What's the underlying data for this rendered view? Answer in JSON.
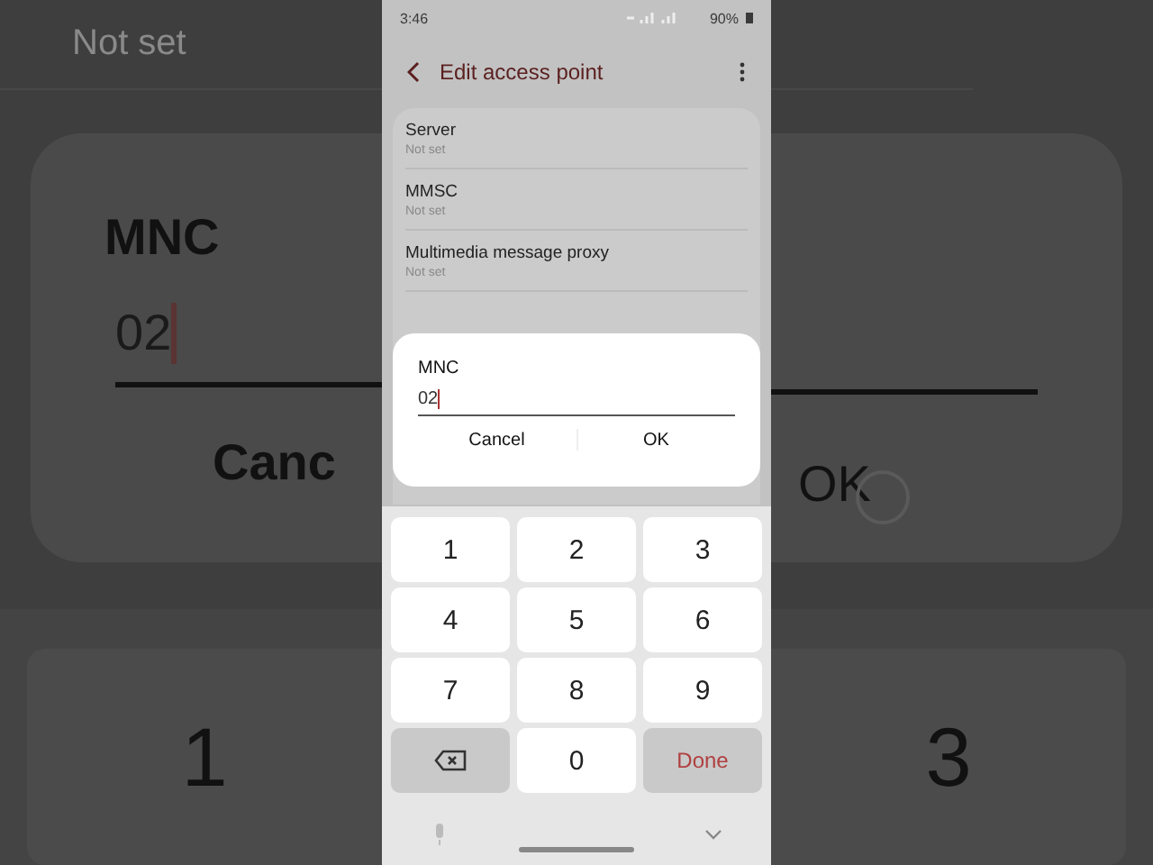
{
  "backdrop_left": {
    "setting_value": "Not set",
    "dialog_title": "MNC",
    "dialog_value": "02",
    "cancel_button": "Canc",
    "key": "1"
  },
  "backdrop_right": {
    "ok_button": "OK",
    "key": "3"
  },
  "status_bar": {
    "time": "3:46",
    "battery": "90%"
  },
  "header": {
    "title": "Edit access point"
  },
  "settings": [
    {
      "label": "Server",
      "value": "Not set"
    },
    {
      "label": "MMSC",
      "value": "Not set"
    },
    {
      "label": "Multimedia message proxy",
      "value": "Not set"
    }
  ],
  "dialog": {
    "title": "MNC",
    "value": "02",
    "buttons": [
      "Cancel",
      "OK"
    ]
  },
  "keypad": {
    "keys": [
      {
        "kind": "digit",
        "label": "1"
      },
      {
        "kind": "digit",
        "label": "2"
      },
      {
        "kind": "digit",
        "label": "3"
      },
      {
        "kind": "digit",
        "label": "4"
      },
      {
        "kind": "digit",
        "label": "5"
      },
      {
        "kind": "digit",
        "label": "6"
      },
      {
        "kind": "digit",
        "label": "7"
      },
      {
        "kind": "digit",
        "label": "8"
      },
      {
        "kind": "digit",
        "label": "9"
      },
      {
        "kind": "backspace"
      },
      {
        "kind": "digit",
        "label": "0"
      },
      {
        "kind": "action",
        "label": "Done"
      }
    ]
  }
}
